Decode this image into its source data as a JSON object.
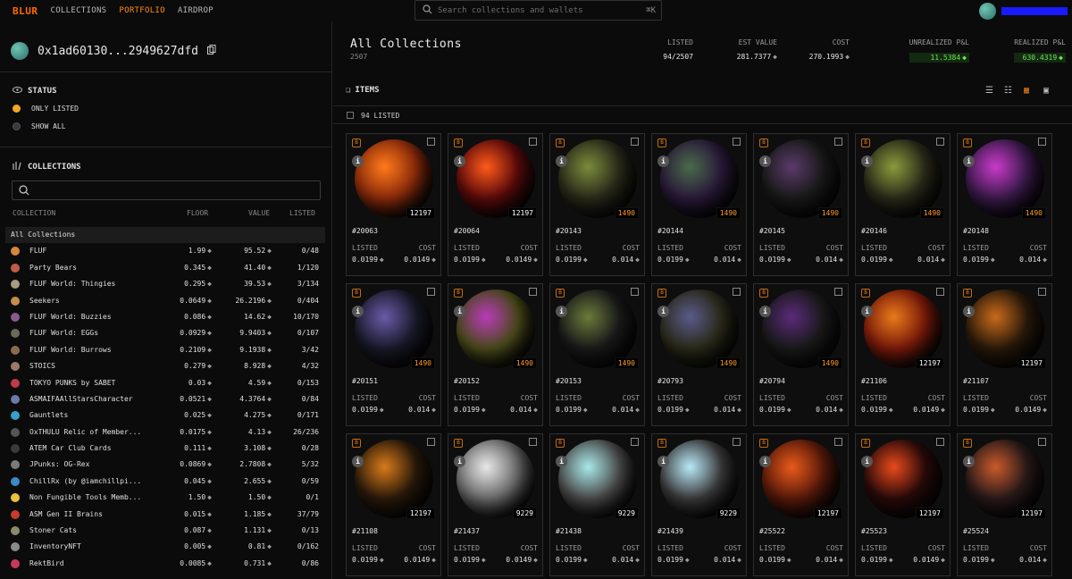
{
  "app": {
    "logo": "BLUR"
  },
  "nav": {
    "collections": "COLLECTIONS",
    "portfolio": "PORTFOLIO",
    "airdrop": "AIRDROP"
  },
  "search": {
    "placeholder": "Search collections and wallets",
    "shortcut": "⌘K"
  },
  "wallet": {
    "address": "0x1ad60130...2949627dfd"
  },
  "status": {
    "title": "STATUS",
    "options": [
      {
        "label": "ONLY LISTED",
        "selected": true,
        "color": "#f2a623"
      },
      {
        "label": "SHOW ALL",
        "selected": false,
        "color": "#3a3a3a"
      }
    ]
  },
  "collections_panel": {
    "title": "COLLECTIONS",
    "headers": {
      "collection": "COLLECTION",
      "floor": "FLOOR",
      "value": "VALUE",
      "listed": "LISTED"
    },
    "all_label": "All Collections",
    "rows": [
      {
        "name": "FLUF",
        "floor": "1.99",
        "value": "95.52",
        "listed": "0/48",
        "color": "#d8843a"
      },
      {
        "name": "Party Bears",
        "floor": "0.345",
        "value": "41.40",
        "listed": "1/120",
        "color": "#c25a4a"
      },
      {
        "name": "FLUF World: Thingies",
        "floor": "0.295",
        "value": "39.53",
        "listed": "3/134",
        "color": "#a99b7f"
      },
      {
        "name": "Seekers",
        "floor": "0.0649",
        "value": "26.2196",
        "listed": "0/404",
        "color": "#c58c4a"
      },
      {
        "name": "FLUF World: Buzzies",
        "floor": "0.086",
        "value": "14.62",
        "listed": "10/170",
        "color": "#8a5a8a"
      },
      {
        "name": "FLUF World: EGGs",
        "floor": "0.0929",
        "value": "9.9403",
        "listed": "0/107",
        "color": "#6a6a5a"
      },
      {
        "name": "FLUF World: Burrows",
        "floor": "0.2109",
        "value": "9.1938",
        "listed": "3/42",
        "color": "#8a6a4a"
      },
      {
        "name": "STOICS",
        "floor": "0.279",
        "value": "8.928",
        "listed": "4/32",
        "color": "#9a7a6a"
      },
      {
        "name": "TOKYO PUNKS by SABET",
        "floor": "0.03",
        "value": "4.59",
        "listed": "0/153",
        "color": "#c23a4a"
      },
      {
        "name": "ASMAIFAAllStarsCharacter",
        "floor": "0.0521",
        "value": "4.3764",
        "listed": "0/84",
        "color": "#6a7aaa"
      },
      {
        "name": "Gauntlets",
        "floor": "0.025",
        "value": "4.275",
        "listed": "0/171",
        "color": "#3aa0c8"
      },
      {
        "name": "OxTHULU Relic of Member...",
        "floor": "0.0175",
        "value": "4.13",
        "listed": "26/236",
        "color": "#555555"
      },
      {
        "name": "ATEM Car Club Cards",
        "floor": "0.111",
        "value": "3.108",
        "listed": "0/28",
        "color": "#3a3a3a"
      },
      {
        "name": "JPunks: OG-Rex",
        "floor": "0.0869",
        "value": "2.7808",
        "listed": "5/32",
        "color": "#7a7a7a"
      },
      {
        "name": "ChillRx (by @iamchillpi...",
        "floor": "0.045",
        "value": "2.655",
        "listed": "0/59",
        "color": "#3a8ac8"
      },
      {
        "name": "Non Fungible Tools Memb...",
        "floor": "1.50",
        "value": "1.50",
        "listed": "0/1",
        "color": "#e8c23a"
      },
      {
        "name": "ASM Gen II Brains",
        "floor": "0.015",
        "value": "1.185",
        "listed": "37/79",
        "color": "#c83a2a"
      },
      {
        "name": "Stoner Cats",
        "floor": "0.087",
        "value": "1.131",
        "listed": "0/13",
        "color": "#8a8a6a"
      },
      {
        "name": "InventoryNFT",
        "floor": "0.005",
        "value": "0.81",
        "listed": "0/162",
        "color": "#8a8a8a"
      },
      {
        "name": "RektBird",
        "floor": "0.0085",
        "value": "0.731",
        "listed": "0/86",
        "color": "#c83a5a"
      }
    ]
  },
  "main": {
    "title": "All Collections",
    "count": "2507",
    "stats": {
      "listed": {
        "label": "LISTED",
        "value": "94/2507"
      },
      "est_value": {
        "label": "EST VALUE",
        "value": "281.7377"
      },
      "cost": {
        "label": "COST",
        "value": "270.1993"
      },
      "unrealized": {
        "label": "UNREALIZED P&L",
        "value": "11.5384"
      },
      "realized": {
        "label": "REALIZED P&L",
        "value": "630.4319"
      }
    },
    "items_title": "ITEMS",
    "listed_count": "94 LISTED",
    "card_labels": {
      "listed": "LISTED",
      "cost": "COST"
    },
    "cards": [
      {
        "token": "#20063",
        "rank": "12197",
        "listed": "0.0199",
        "cost": "0.0149",
        "c1": "#ff7a1a",
        "c2": "#8a2a0a",
        "rankColor": "white"
      },
      {
        "token": "#20064",
        "rank": "12197",
        "listed": "0.0199",
        "cost": "0.0149",
        "c1": "#ff5a1a",
        "c2": "#5a0a0a",
        "rankColor": "white"
      },
      {
        "token": "#20143",
        "rank": "1490",
        "listed": "0.0199",
        "cost": "0.014",
        "c1": "#7a8a3a",
        "c2": "#2a2a1a",
        "rankColor": "orange"
      },
      {
        "token": "#20144",
        "rank": "1490",
        "listed": "0.0199",
        "cost": "0.014",
        "c1": "#4a6a4a",
        "c2": "#2a1a3a",
        "rankColor": "orange"
      },
      {
        "token": "#20145",
        "rank": "1490",
        "listed": "0.0199",
        "cost": "0.014",
        "c1": "#5a3a6a",
        "c2": "#1a1a1a",
        "rankColor": "orange"
      },
      {
        "token": "#20146",
        "rank": "1490",
        "listed": "0.0199",
        "cost": "0.014",
        "c1": "#8a9a3a",
        "c2": "#2a2a1a",
        "rankColor": "orange"
      },
      {
        "token": "#20148",
        "rank": "1490",
        "listed": "0.0199",
        "cost": "0.014",
        "c1": "#c83ac8",
        "c2": "#3a1a4a",
        "rankColor": "orange"
      },
      {
        "token": "#20151",
        "rank": "1490",
        "listed": "0.0199",
        "cost": "0.014",
        "c1": "#6a5aa8",
        "c2": "#1a1a2a",
        "rankColor": "orange"
      },
      {
        "token": "#20152",
        "rank": "1490",
        "listed": "0.0199",
        "cost": "0.014",
        "c1": "#b83ab8",
        "c2": "#4a4a1a",
        "rankColor": "orange"
      },
      {
        "token": "#20153",
        "rank": "1490",
        "listed": "0.0199",
        "cost": "0.014",
        "c1": "#6a7a3a",
        "c2": "#1a1a1a",
        "rankColor": "orange"
      },
      {
        "token": "#20793",
        "rank": "1490",
        "listed": "0.0199",
        "cost": "0.014",
        "c1": "#5a5a8a",
        "c2": "#2a2a1a",
        "rankColor": "orange"
      },
      {
        "token": "#20794",
        "rank": "1490",
        "listed": "0.0199",
        "cost": "0.014",
        "c1": "#5a2a7a",
        "c2": "#1a1a1a",
        "rankColor": "orange"
      },
      {
        "token": "#21106",
        "rank": "12197",
        "listed": "0.0199",
        "cost": "0.0149",
        "c1": "#e87a1a",
        "c2": "#7a1a0a",
        "rankColor": "white"
      },
      {
        "token": "#21107",
        "rank": "12197",
        "listed": "0.0199",
        "cost": "0.0149",
        "c1": "#c86a1a",
        "c2": "#2a1a0a",
        "rankColor": "white"
      },
      {
        "token": "#21108",
        "rank": "12197",
        "listed": "0.0199",
        "cost": "0.0149",
        "c1": "#d87a1a",
        "c2": "#2a1a0a",
        "rankColor": "white"
      },
      {
        "token": "#21437",
        "rank": "9229",
        "listed": "0.0199",
        "cost": "0.0149",
        "c1": "#e8e8e8",
        "c2": "#6a6a6a",
        "rankColor": "white"
      },
      {
        "token": "#21438",
        "rank": "9229",
        "listed": "0.0199",
        "cost": "0.014",
        "c1": "#a8e8e8",
        "c2": "#4a4a4a",
        "rankColor": "white"
      },
      {
        "token": "#21439",
        "rank": "9229",
        "listed": "0.0199",
        "cost": "0.014",
        "c1": "#b8e8f8",
        "c2": "#3a3a3a",
        "rankColor": "white"
      },
      {
        "token": "#25522",
        "rank": "12197",
        "listed": "0.0199",
        "cost": "0.014",
        "c1": "#e85a1a",
        "c2": "#5a1a0a",
        "rankColor": "white"
      },
      {
        "token": "#25523",
        "rank": "12197",
        "listed": "0.0199",
        "cost": "0.0149",
        "c1": "#e84a1a",
        "c2": "#2a0a0a",
        "rankColor": "white"
      },
      {
        "token": "#25524",
        "rank": "12197",
        "listed": "0.0199",
        "cost": "0.014",
        "c1": "#c85a2a",
        "c2": "#2a1a1a",
        "rankColor": "white"
      }
    ]
  },
  "colors": {
    "brand": "#ff6a00",
    "accent": "#ff8a1a",
    "profit": "#6fe35a"
  }
}
